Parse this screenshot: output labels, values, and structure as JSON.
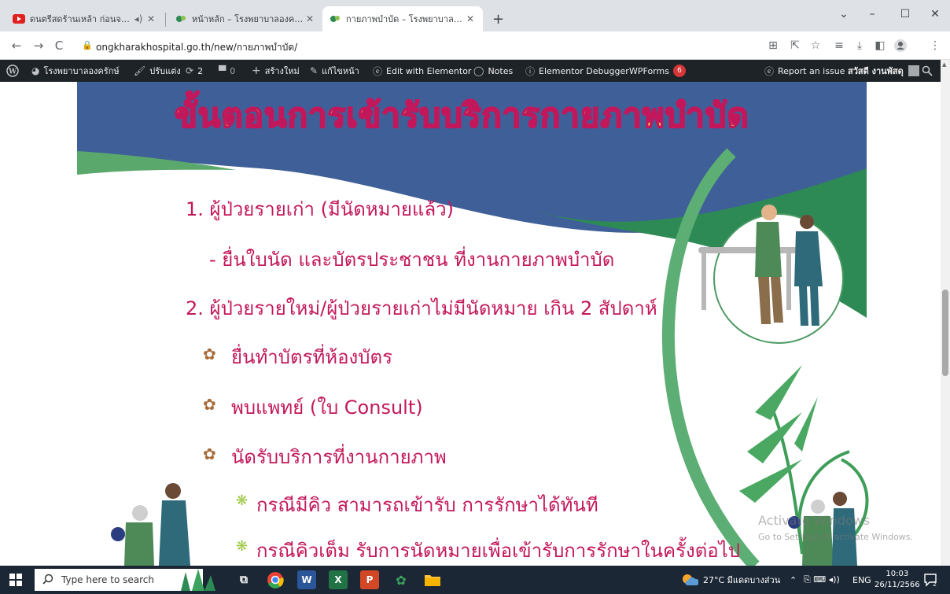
{
  "browser": {
    "tabs": [
      {
        "title": "ดนตรีสดร้านเหล้า ก่อนจะจัก ยุคบ",
        "active": false
      },
      {
        "title": "หน้าหลัก – โรงพยาบาลองครักษ์",
        "active": false
      },
      {
        "title": "กายภาพบำบัด – โรงพยาบาลองครักษ์",
        "active": true
      }
    ],
    "new_tab": "+",
    "url": "ongkharakhospital.go.th/new/กายภาพบำบัด/"
  },
  "adminbar": {
    "site_name": "โรงพยาบาลองครักษ์",
    "customize": "ปรับแต่ง",
    "updates_count": "2",
    "comments_count": "0",
    "new_label": "สร้างใหม่",
    "edit_page": "แก้ไขหน้า",
    "elementor": "Edit with Elementor",
    "notes": "Notes",
    "debugger": "Elementor Debugger",
    "wpforms": "WPForms",
    "wpforms_badge": "6",
    "report": "Report an issue",
    "howdy": "สวัสดี งานพัสดุ"
  },
  "content": {
    "title": "ขั้นตอนการเข้ารับบริการกายภาพบำบัด",
    "items": [
      "1. ผู้ป่วยรายเก่า  (มีนัดหมายแล้ว)",
      "- ยื่นใบนัด  และบัตรประชาชน  ที่งานกายภาพบำบัด",
      "2. ผู้ป่วยรายใหม่/ผู้ป่วยรายเก่าไม่มีนัดหมาย เกิน 2 สัปดาห์",
      "ยื่นทำบัตรที่ห้องบัตร",
      "พบแพทย์ (ใบ Consult)",
      "นัดรับบริการที่งานกายภาพ",
      "กรณีมีคิว  สามารถเข้ารับ  การรักษาได้ทันที",
      "กรณีคิวเต็ม  รับการนัดหมายเพื่อเข้ารับการรักษาในครั้งต่อไป"
    ],
    "watermark_line1": "Activate Windows",
    "watermark_line2": "Go to Settings to activate Windows."
  },
  "taskbar": {
    "search_placeholder": "Type here to search",
    "weather": "27°C  มีแดดบางส่วน",
    "lang": "ENG",
    "time": "10:03",
    "date": "26/11/2566",
    "notif_count": "2"
  },
  "colors": {
    "title_fill": "#f7e23a",
    "title_outline": "#c2185b",
    "text_pink": "#c2185b",
    "star": "#a86c3a",
    "leaf": "#9bc53d",
    "wave_blue": "#3f5f98",
    "wave_green": "#2e8a55"
  }
}
